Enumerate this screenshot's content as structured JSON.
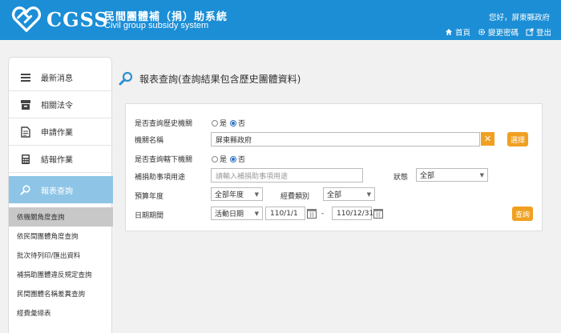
{
  "header": {
    "logo": "CGSS",
    "title": "民間團體補（捐）助系統",
    "subtitle": "Civil group subsidy system",
    "greeting": "您好，屏東縣政府",
    "links": {
      "home": "首頁",
      "change_password": "變更密碼",
      "logout": "登出"
    }
  },
  "sidebar": {
    "items": [
      {
        "label": "最新消息",
        "icon": "list-icon"
      },
      {
        "label": "相關法令",
        "icon": "archive-icon"
      },
      {
        "label": "申請作業",
        "icon": "document-icon"
      },
      {
        "label": "結報作業",
        "icon": "calculator-icon"
      },
      {
        "label": "報表查詢",
        "icon": "search-icon"
      }
    ],
    "subitems": [
      "依機關角度查詢",
      "依民間團體角度查詢",
      "批次待列印/匯出資料",
      "補捐助團體違反規定查詢",
      "民間團體名稱差異查詢",
      "經費彙總表"
    ]
  },
  "main": {
    "title": "報表查詢(查詢結果包含歷史團體資料)",
    "form": {
      "history_label": "是否查詢歷史機關",
      "yes": "是",
      "no": "否",
      "agency_label": "機關名稱",
      "agency_value": "屏東縣政府",
      "select_button": "選擇",
      "subordinate_label": "是否查詢轄下機關",
      "purpose_label": "補捐助事項用途",
      "purpose_placeholder": "請輸入補捐助事項用途",
      "status_label": "狀態",
      "status_value": "全部",
      "year_label": "預算年度",
      "year_value": "全部年度",
      "category_label": "經費類別",
      "category_value": "全部",
      "date_label": "日期期間",
      "date_type": "活動日期",
      "date_from": "110/1/1",
      "date_sep": "-",
      "date_to": "110/12/31",
      "query_button": "查詢"
    }
  },
  "colors": {
    "header": "#1b8ed6",
    "accent": "#f0a020",
    "active_menu": "#8ec5e6"
  }
}
